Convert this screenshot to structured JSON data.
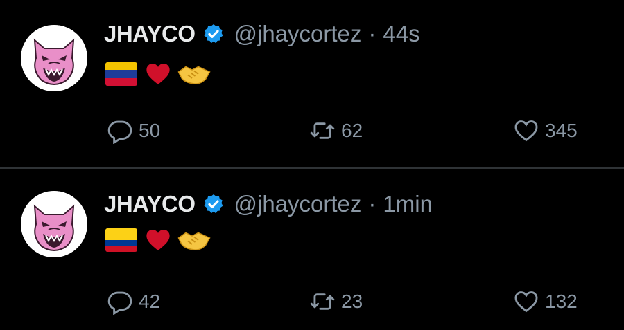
{
  "tweets": [
    {
      "name": "JHAYCO",
      "handle": "@jhaycortez",
      "separator": "·",
      "time": "44s",
      "flag": "venezuela-flag",
      "flag_colors": [
        "#f4c300",
        "#1e3c9a",
        "#d21034"
      ],
      "replies": "50",
      "retweets": "62",
      "likes": "345"
    },
    {
      "name": "JHAYCO",
      "handle": "@jhaycortez",
      "separator": "·",
      "time": "1min",
      "flag": "colombia-flag",
      "flag_colors": [
        "#fcd116",
        "#fcd116",
        "#003893",
        "#ce1126"
      ],
      "replies": "42",
      "retweets": "23",
      "likes": "132"
    }
  ],
  "colors": {
    "background": "#000000",
    "text": "#e7e9ea",
    "muted": "#8b98a5",
    "verified": "#1d9bf0",
    "divider": "#2f3336",
    "heart": "#d0102a",
    "avatar_pink": "#e98fc8"
  },
  "icons": [
    "reply-icon",
    "retweet-icon",
    "like-icon",
    "verified-icon"
  ]
}
